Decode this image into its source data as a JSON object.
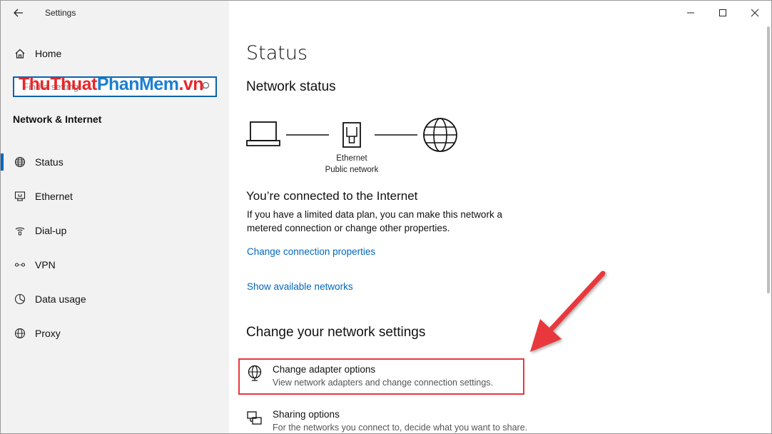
{
  "app": {
    "title": "Settings"
  },
  "sidebar": {
    "home_label": "Home",
    "search_placeholder": "Find a setting",
    "watermark": {
      "part1": "ThuThuat",
      "part2": "PhanMem",
      "part3": ".vn"
    },
    "section_title": "Network & Internet",
    "items": [
      {
        "label": "Status",
        "icon": "globe-status-icon",
        "active": true
      },
      {
        "label": "Ethernet",
        "icon": "ethernet-icon",
        "active": false
      },
      {
        "label": "Dial-up",
        "icon": "dial-up-icon",
        "active": false
      },
      {
        "label": "VPN",
        "icon": "vpn-icon",
        "active": false
      },
      {
        "label": "Data usage",
        "icon": "data-usage-icon",
        "active": false
      },
      {
        "label": "Proxy",
        "icon": "proxy-globe-icon",
        "active": false
      }
    ]
  },
  "main": {
    "page_title": "Status",
    "network_status_heading": "Network status",
    "diagram": {
      "adapter_name": "Ethernet",
      "network_type": "Public network"
    },
    "connected_heading": "You’re connected to the Internet",
    "connected_text": "If you have a limited data plan, you can make this network a metered connection or change other properties.",
    "link_change_connection": "Change connection properties",
    "link_show_networks": "Show available networks",
    "change_settings_heading": "Change your network settings",
    "options": [
      {
        "title": "Change adapter options",
        "description": "View network adapters and change connection settings.",
        "icon": "adapter-options-icon"
      },
      {
        "title": "Sharing options",
        "description": "For the networks you connect to, decide what you want to share.",
        "icon": "sharing-options-icon"
      }
    ]
  },
  "colors": {
    "accent": "#0067c0",
    "annotation_red": "#e8383d",
    "sidebar_bg": "#f2f2f2"
  }
}
